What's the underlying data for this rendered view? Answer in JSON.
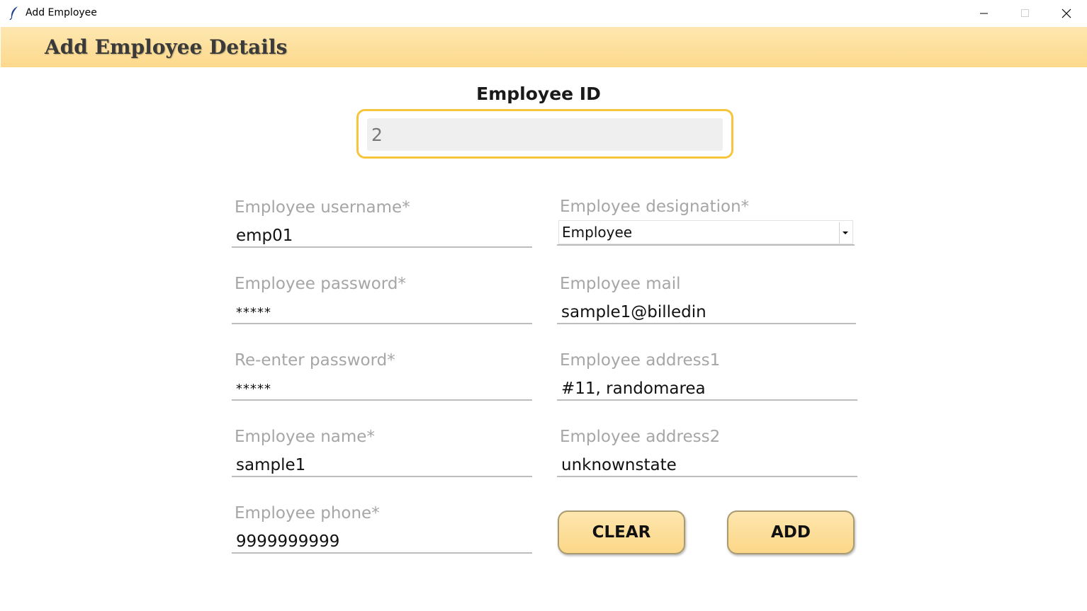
{
  "window": {
    "title": "Add Employee"
  },
  "header": {
    "title": "Add Employee Details"
  },
  "employee_id": {
    "label": "Employee ID",
    "value": "2"
  },
  "left_fields": [
    {
      "label": "Employee username*",
      "value": "emp01"
    },
    {
      "label": "Employee password*",
      "value": "*****"
    },
    {
      "label": "Re-enter password*",
      "value": "*****"
    },
    {
      "label": "Employee name*",
      "value": "sample1"
    },
    {
      "label": "Employee phone*",
      "value": "9999999999"
    }
  ],
  "right_fields": {
    "designation": {
      "label": "Employee designation*",
      "selected": "Employee"
    },
    "mail": {
      "label": "Employee mail",
      "value": "sample1@billedin"
    },
    "address1": {
      "label": "Employee address1",
      "value": "#11, randomarea"
    },
    "address2": {
      "label": "Employee address2",
      "value": "unknownstate"
    }
  },
  "buttons": {
    "clear": "CLEAR",
    "add": "ADD"
  },
  "colors": {
    "header_band": "#fdd98c",
    "id_border": "#f7c53d",
    "button_fill": "#fcd788"
  }
}
